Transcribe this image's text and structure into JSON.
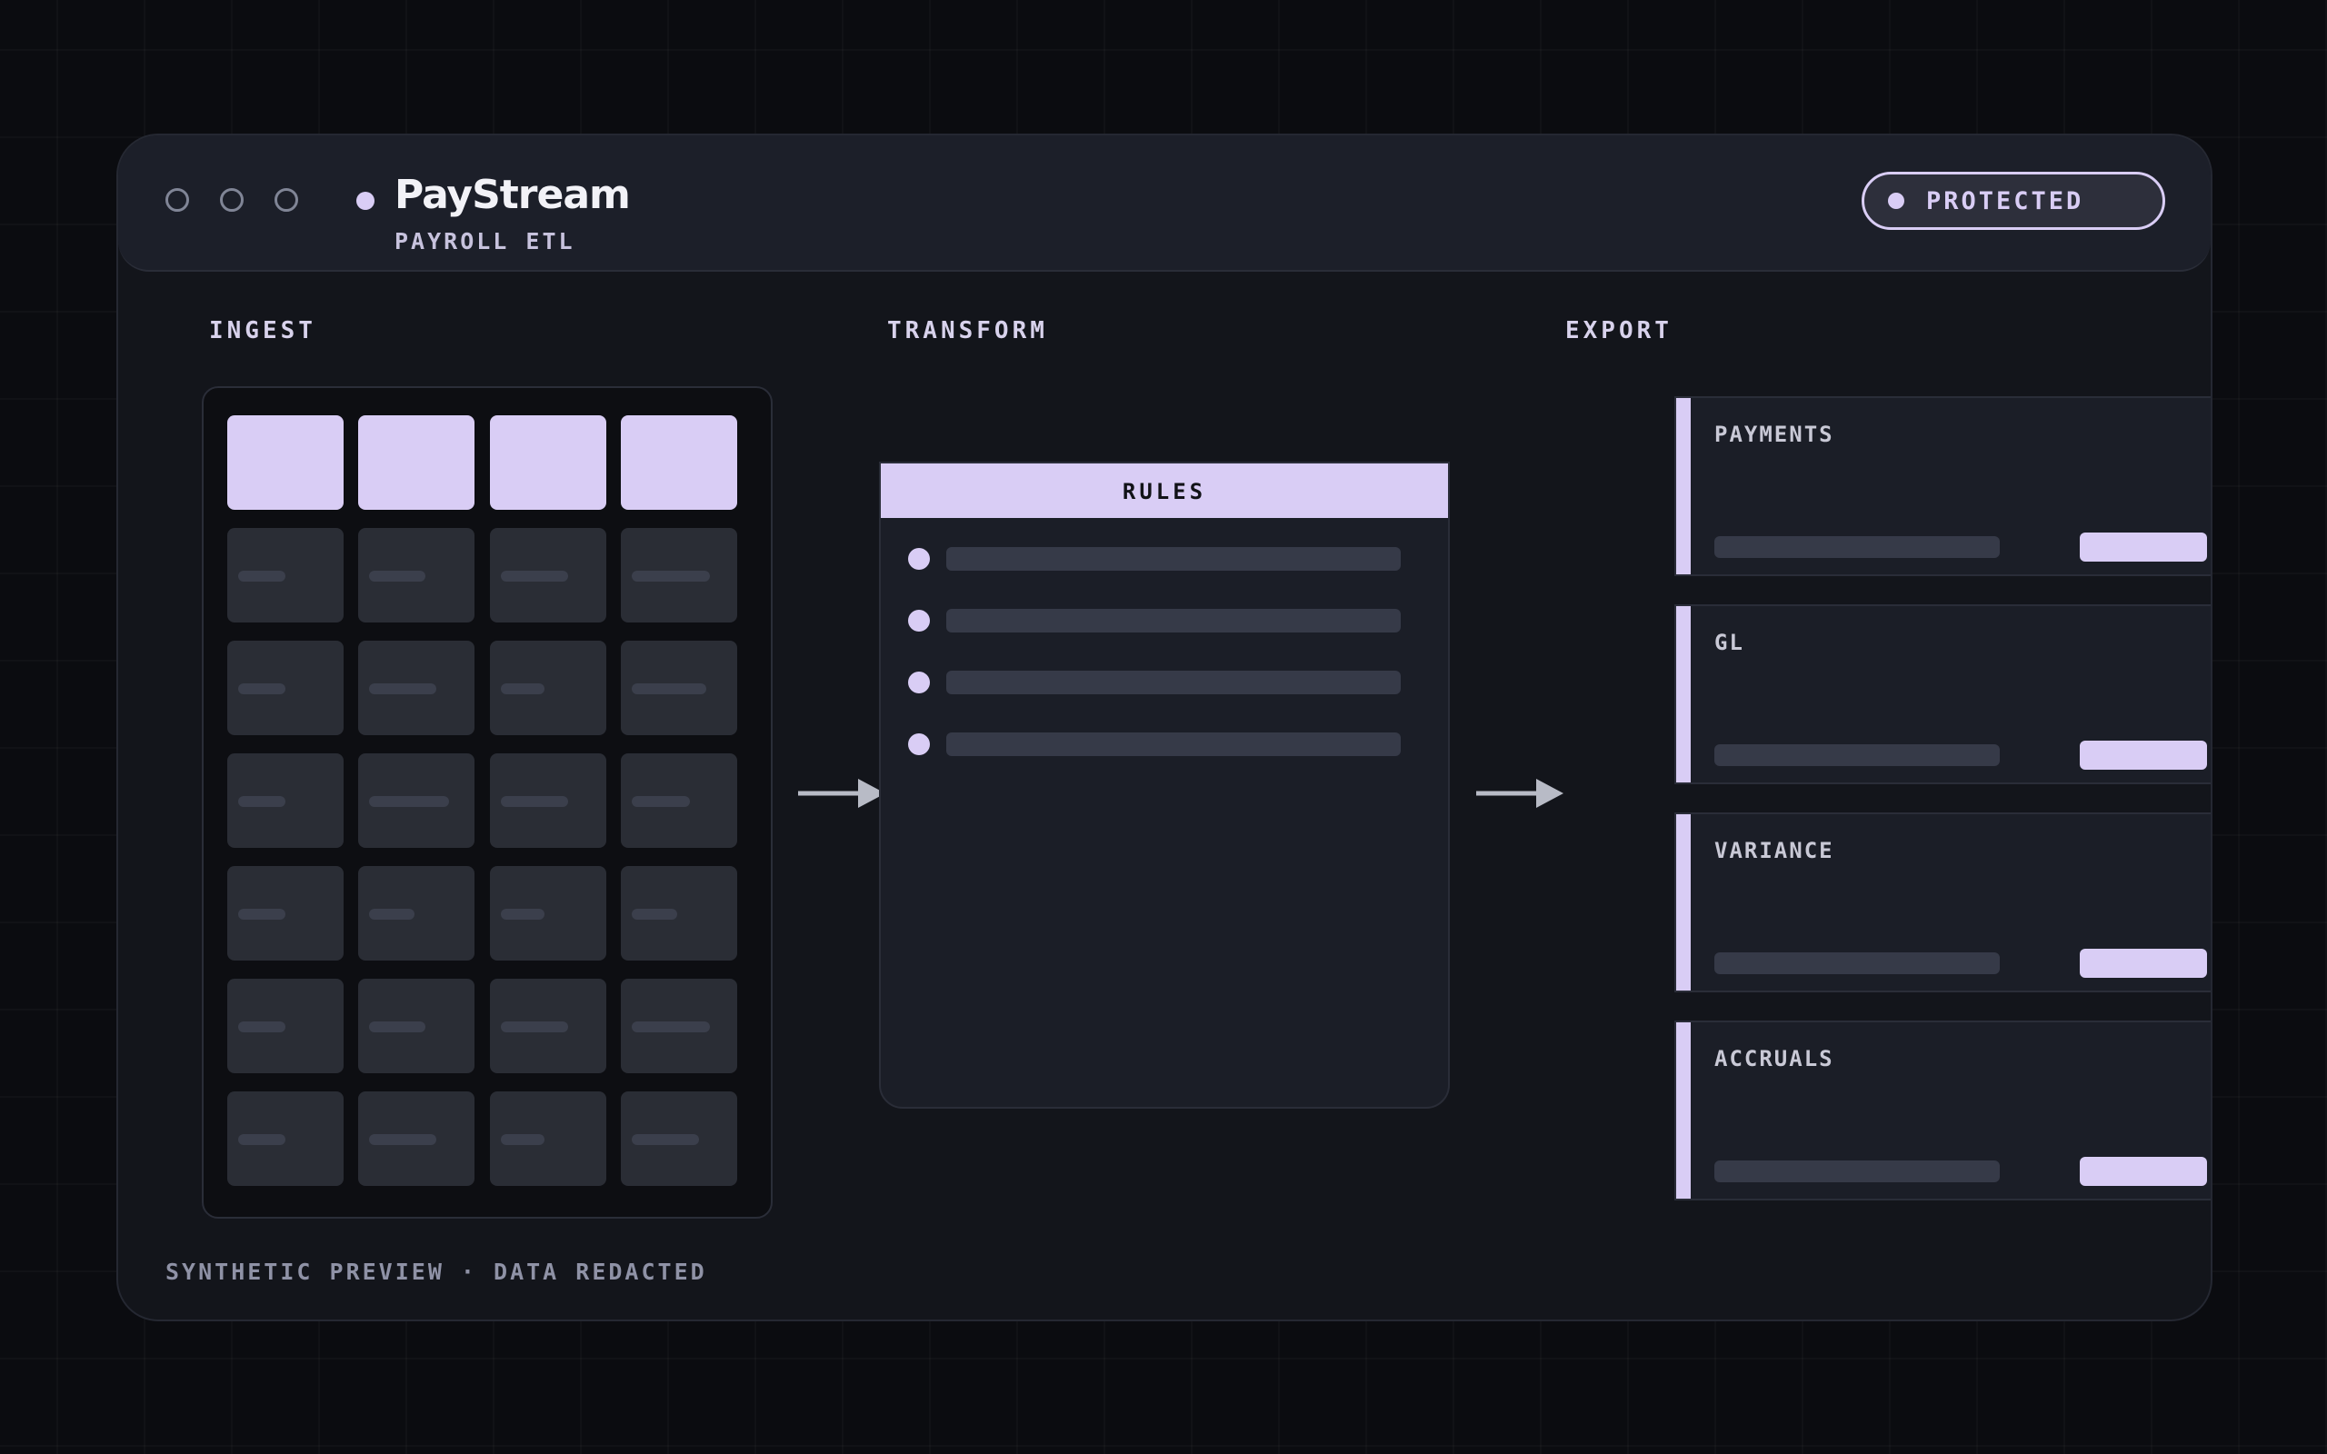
{
  "header": {
    "window_controls": [
      "circle-control",
      "circle-control",
      "circle-control"
    ],
    "app_name": "PayStream",
    "app_subtitle": "PAYROLL ETL",
    "badge": {
      "label": "PROTECTED",
      "icon": "status-dot-icon"
    }
  },
  "sections": {
    "ingest": {
      "label": "INGEST"
    },
    "transform": {
      "label": "TRANSFORM",
      "panel_title": "RULES",
      "rule_count": 4
    },
    "export": {
      "label": "EXPORT"
    }
  },
  "export_targets": [
    {
      "label": "PAYMENTS"
    },
    {
      "label": "GL"
    },
    {
      "label": "VARIANCE"
    },
    {
      "label": "ACCRUALS"
    }
  ],
  "footer": {
    "note": "SYNTHETIC PREVIEW · DATA REDACTED"
  },
  "colors": {
    "background": "#0b0c10",
    "window": "#13151b",
    "titlebar": "#1c1f29",
    "accent": "#d9cdf5",
    "placeholder_cell": "#2a2d35",
    "placeholder_bar": "#363a48"
  }
}
